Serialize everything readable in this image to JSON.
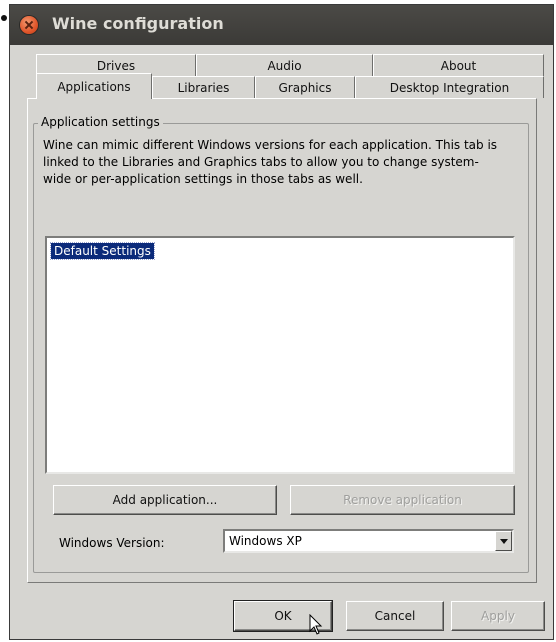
{
  "window": {
    "title": "Wine configuration"
  },
  "tabs": {
    "back_row": [
      "Drives",
      "Audio",
      "About"
    ],
    "front_row": [
      "Applications",
      "Libraries",
      "Graphics",
      "Desktop Integration"
    ],
    "active": "Applications"
  },
  "app_settings": {
    "group_title": "Application settings",
    "description": "Wine can mimic different Windows versions for each application. This tab is linked to the Libraries and Graphics tabs to allow you to change system-wide or per-application settings in those tabs as well.",
    "list_items": [
      "Default Settings"
    ],
    "selected_item": "Default Settings",
    "add_button": "Add application...",
    "remove_button": "Remove application",
    "windows_version_label": "Windows Version:",
    "windows_version_value": "Windows XP"
  },
  "footer": {
    "ok": "OK",
    "cancel": "Cancel",
    "apply": "Apply"
  },
  "icons": {
    "close": "close-icon",
    "dropdown": "chevron-down-icon",
    "cursor": "mouse-pointer-icon"
  },
  "colors": {
    "titlebar": "#3b3a37",
    "close_button": "#e0552a",
    "selection": "#0b2a7a",
    "window_bg": "#d6d5d1"
  }
}
